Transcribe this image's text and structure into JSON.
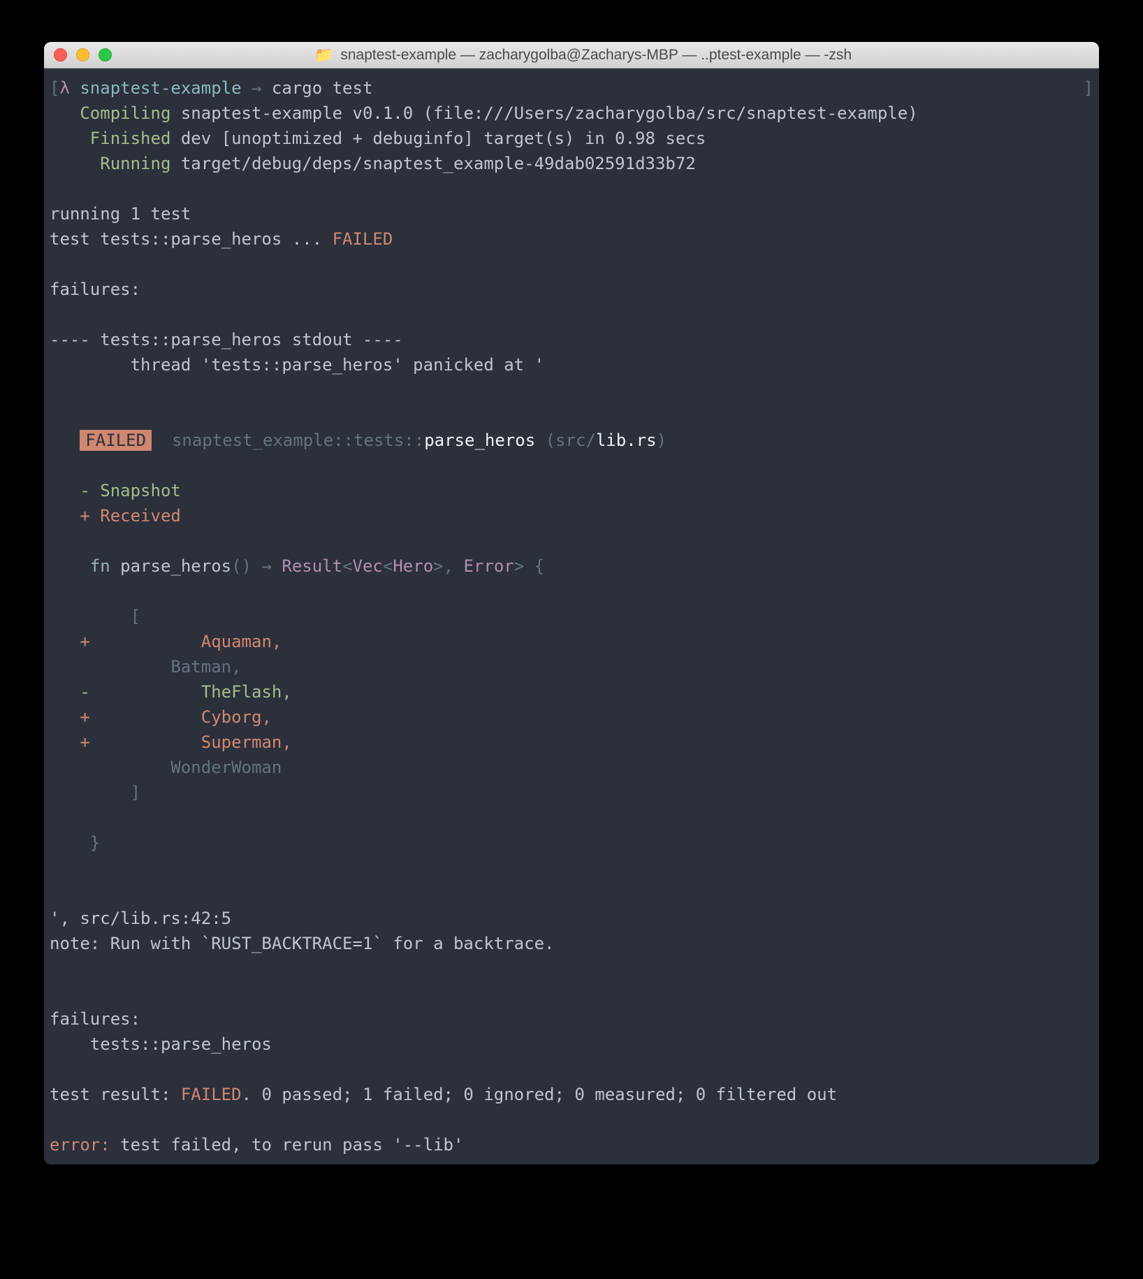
{
  "titlebar": {
    "folder_icon": "📁",
    "title": "snaptest-example — zacharygolba@Zacharys-MBP — ..ptest-example — -zsh"
  },
  "prompt": {
    "lambda": "λ",
    "dir": "snaptest-example",
    "arrow": "→",
    "command": "cargo test"
  },
  "compile": {
    "compiling_label": "Compiling",
    "compiling_text": "snaptest-example v0.1.0 (file:///Users/zacharygolba/src/snaptest-example)",
    "finished_label": "Finished",
    "finished_text": "dev [unoptimized + debuginfo] target(s) in 0.98 secs",
    "running_label": "Running",
    "running_text": "target/debug/deps/snaptest_example-49dab02591d33b72"
  },
  "tests": {
    "running": "running 1 test",
    "test_line_prefix": "test tests::parse_heros ... ",
    "failed": "FAILED"
  },
  "failures_header": "failures:",
  "stdout_header": "---- tests::parse_heros stdout ----",
  "panic_line": "        thread 'tests::parse_heros' panicked at '",
  "badge": {
    "failed": "FAILED",
    "path_dim": "snaptest_example::tests::",
    "test_name": "parse_heros",
    "src_open": " (src/",
    "lib": "lib.rs",
    "close": ")"
  },
  "diff": {
    "snapshot": "- Snapshot",
    "received": "+ Received",
    "fn_kw": "fn ",
    "fn_name": "parse_heros",
    "fn_sig_parens": "() ",
    "arrow": "→ ",
    "result": "Result",
    "angle1": "<",
    "vec": "Vec",
    "angle2": "<",
    "hero": "Hero",
    "angle3": ">, ",
    "error": "Error",
    "angle4": "> {",
    "bracket_open": "        [",
    "plus_aquaman_prefix": "+           ",
    "aquaman": "Aquaman,",
    "batman": "            Batman,",
    "minus_flash_prefix": "-           ",
    "theflash": "TheFlash,",
    "plus_cyborg_prefix": "+           ",
    "cyborg": "Cyborg,",
    "plus_superman_prefix": "+           ",
    "superman": "Superman,",
    "wonderwoman": "            WonderWoman",
    "bracket_close": "        ]",
    "brace_close": "    }"
  },
  "trace": {
    "location": "', src/lib.rs:42:5",
    "note": "note: Run with `RUST_BACKTRACE=1` for a backtrace."
  },
  "summary": {
    "failures": "failures:",
    "test_name": "    tests::parse_heros",
    "result_prefix": "test result: ",
    "failed": "FAILED",
    "result_suffix": ". 0 passed; 1 failed; 0 ignored; 0 measured; 0 filtered out",
    "error_label": "error:",
    "error_text": " test failed, to rerun pass '--lib'"
  }
}
